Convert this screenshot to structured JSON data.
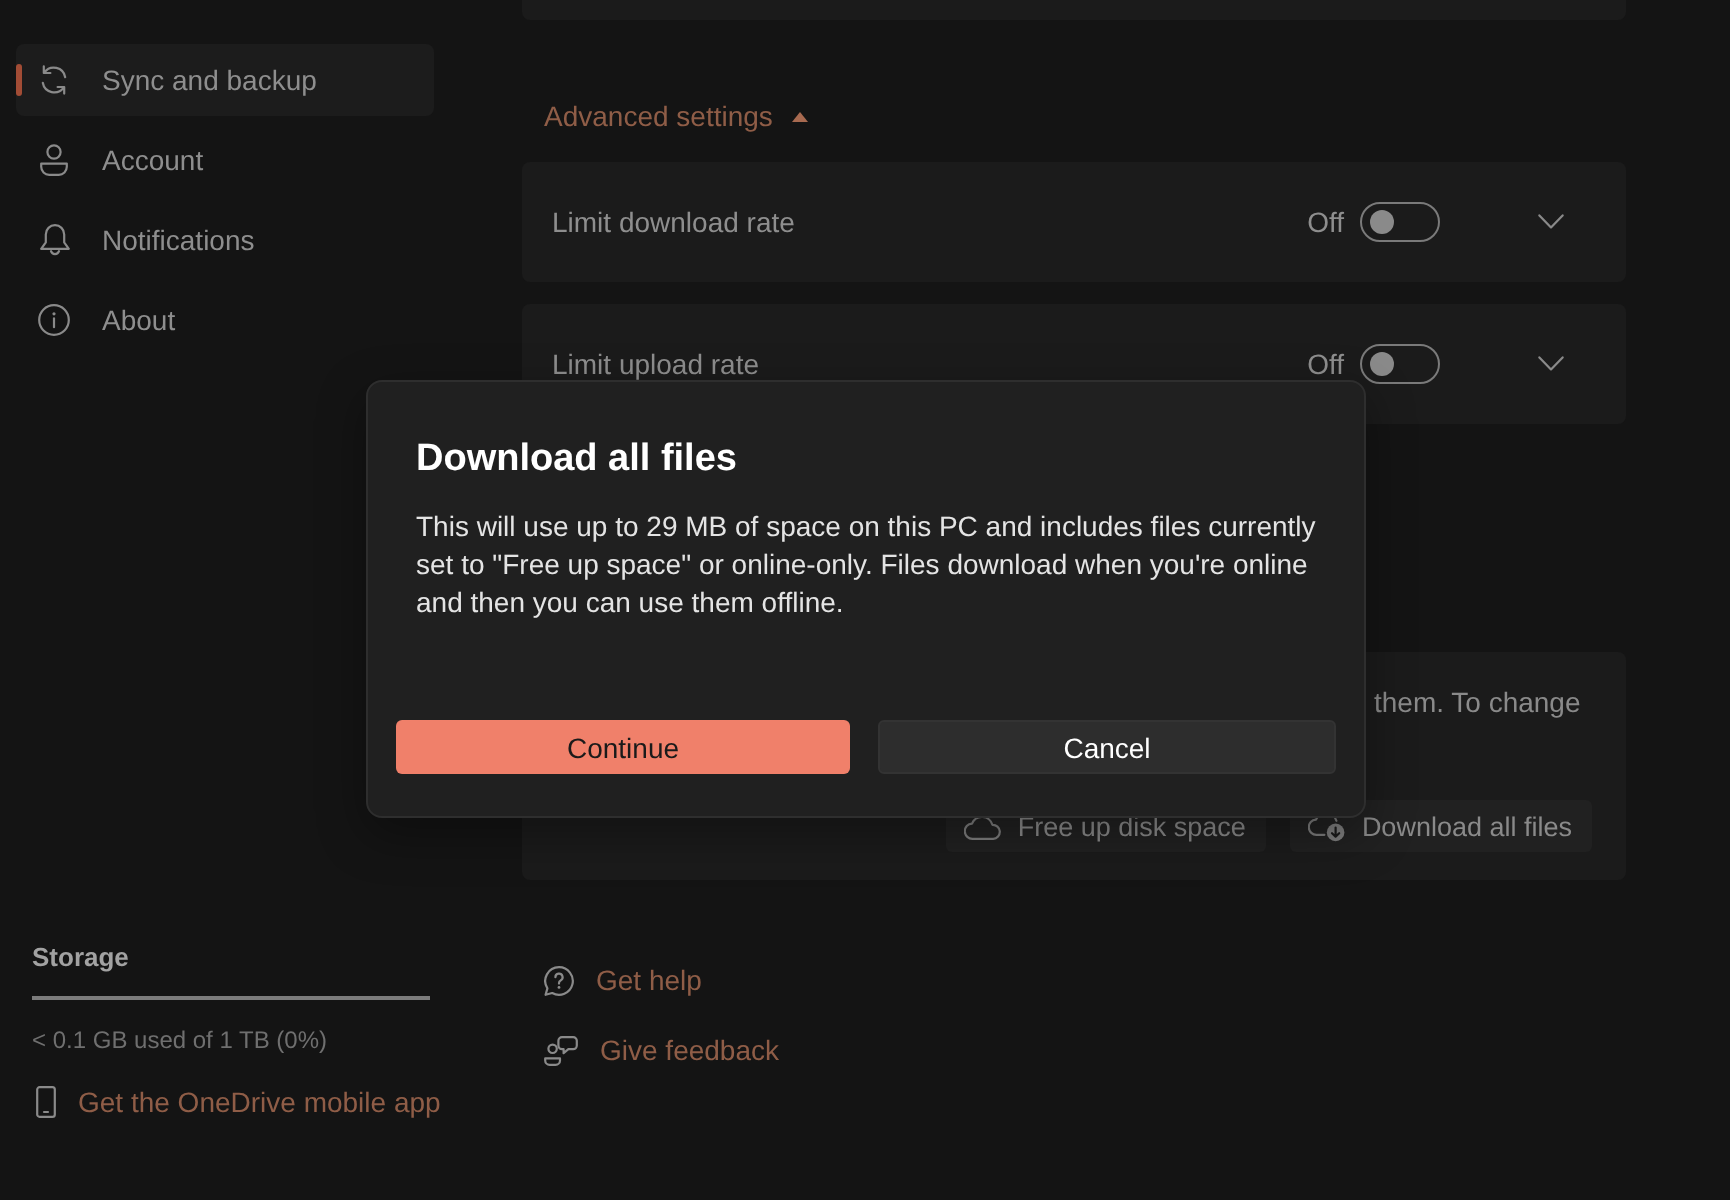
{
  "sidebar": {
    "items": [
      {
        "label": "Sync and backup",
        "selected": true
      },
      {
        "label": "Account",
        "selected": false
      },
      {
        "label": "Notifications",
        "selected": false
      },
      {
        "label": "About",
        "selected": false
      }
    ],
    "storage": {
      "title": "Storage",
      "level": 0,
      "usage": "< 0.1 GB used of 1 TB (0%)"
    },
    "mobile_app_link": "Get the OneDrive mobile app"
  },
  "main": {
    "advanced_settings": {
      "label": "Advanced settings",
      "expanded": true
    },
    "settings": [
      {
        "label": "Limit download rate",
        "state_text": "Off",
        "on": false,
        "expanded": false
      },
      {
        "label": "Limit upload rate",
        "state_text": "Off",
        "on": false,
        "expanded": false
      }
    ],
    "files_card": {
      "text": "them. To change",
      "buttons": [
        "Free up disk space",
        "Download all files"
      ]
    },
    "links": [
      "Get help",
      "Give feedback"
    ]
  },
  "dialog": {
    "title": "Download all files",
    "body": "This will use up to 29 MB of space on this PC and includes files currently set to \"Free up space\" or online-only. Files download when you're online and then you can use them offline.",
    "buttons": [
      {
        "label": "Continue",
        "kind": "primary"
      },
      {
        "label": "Cancel",
        "kind": "secondary"
      }
    ]
  }
}
